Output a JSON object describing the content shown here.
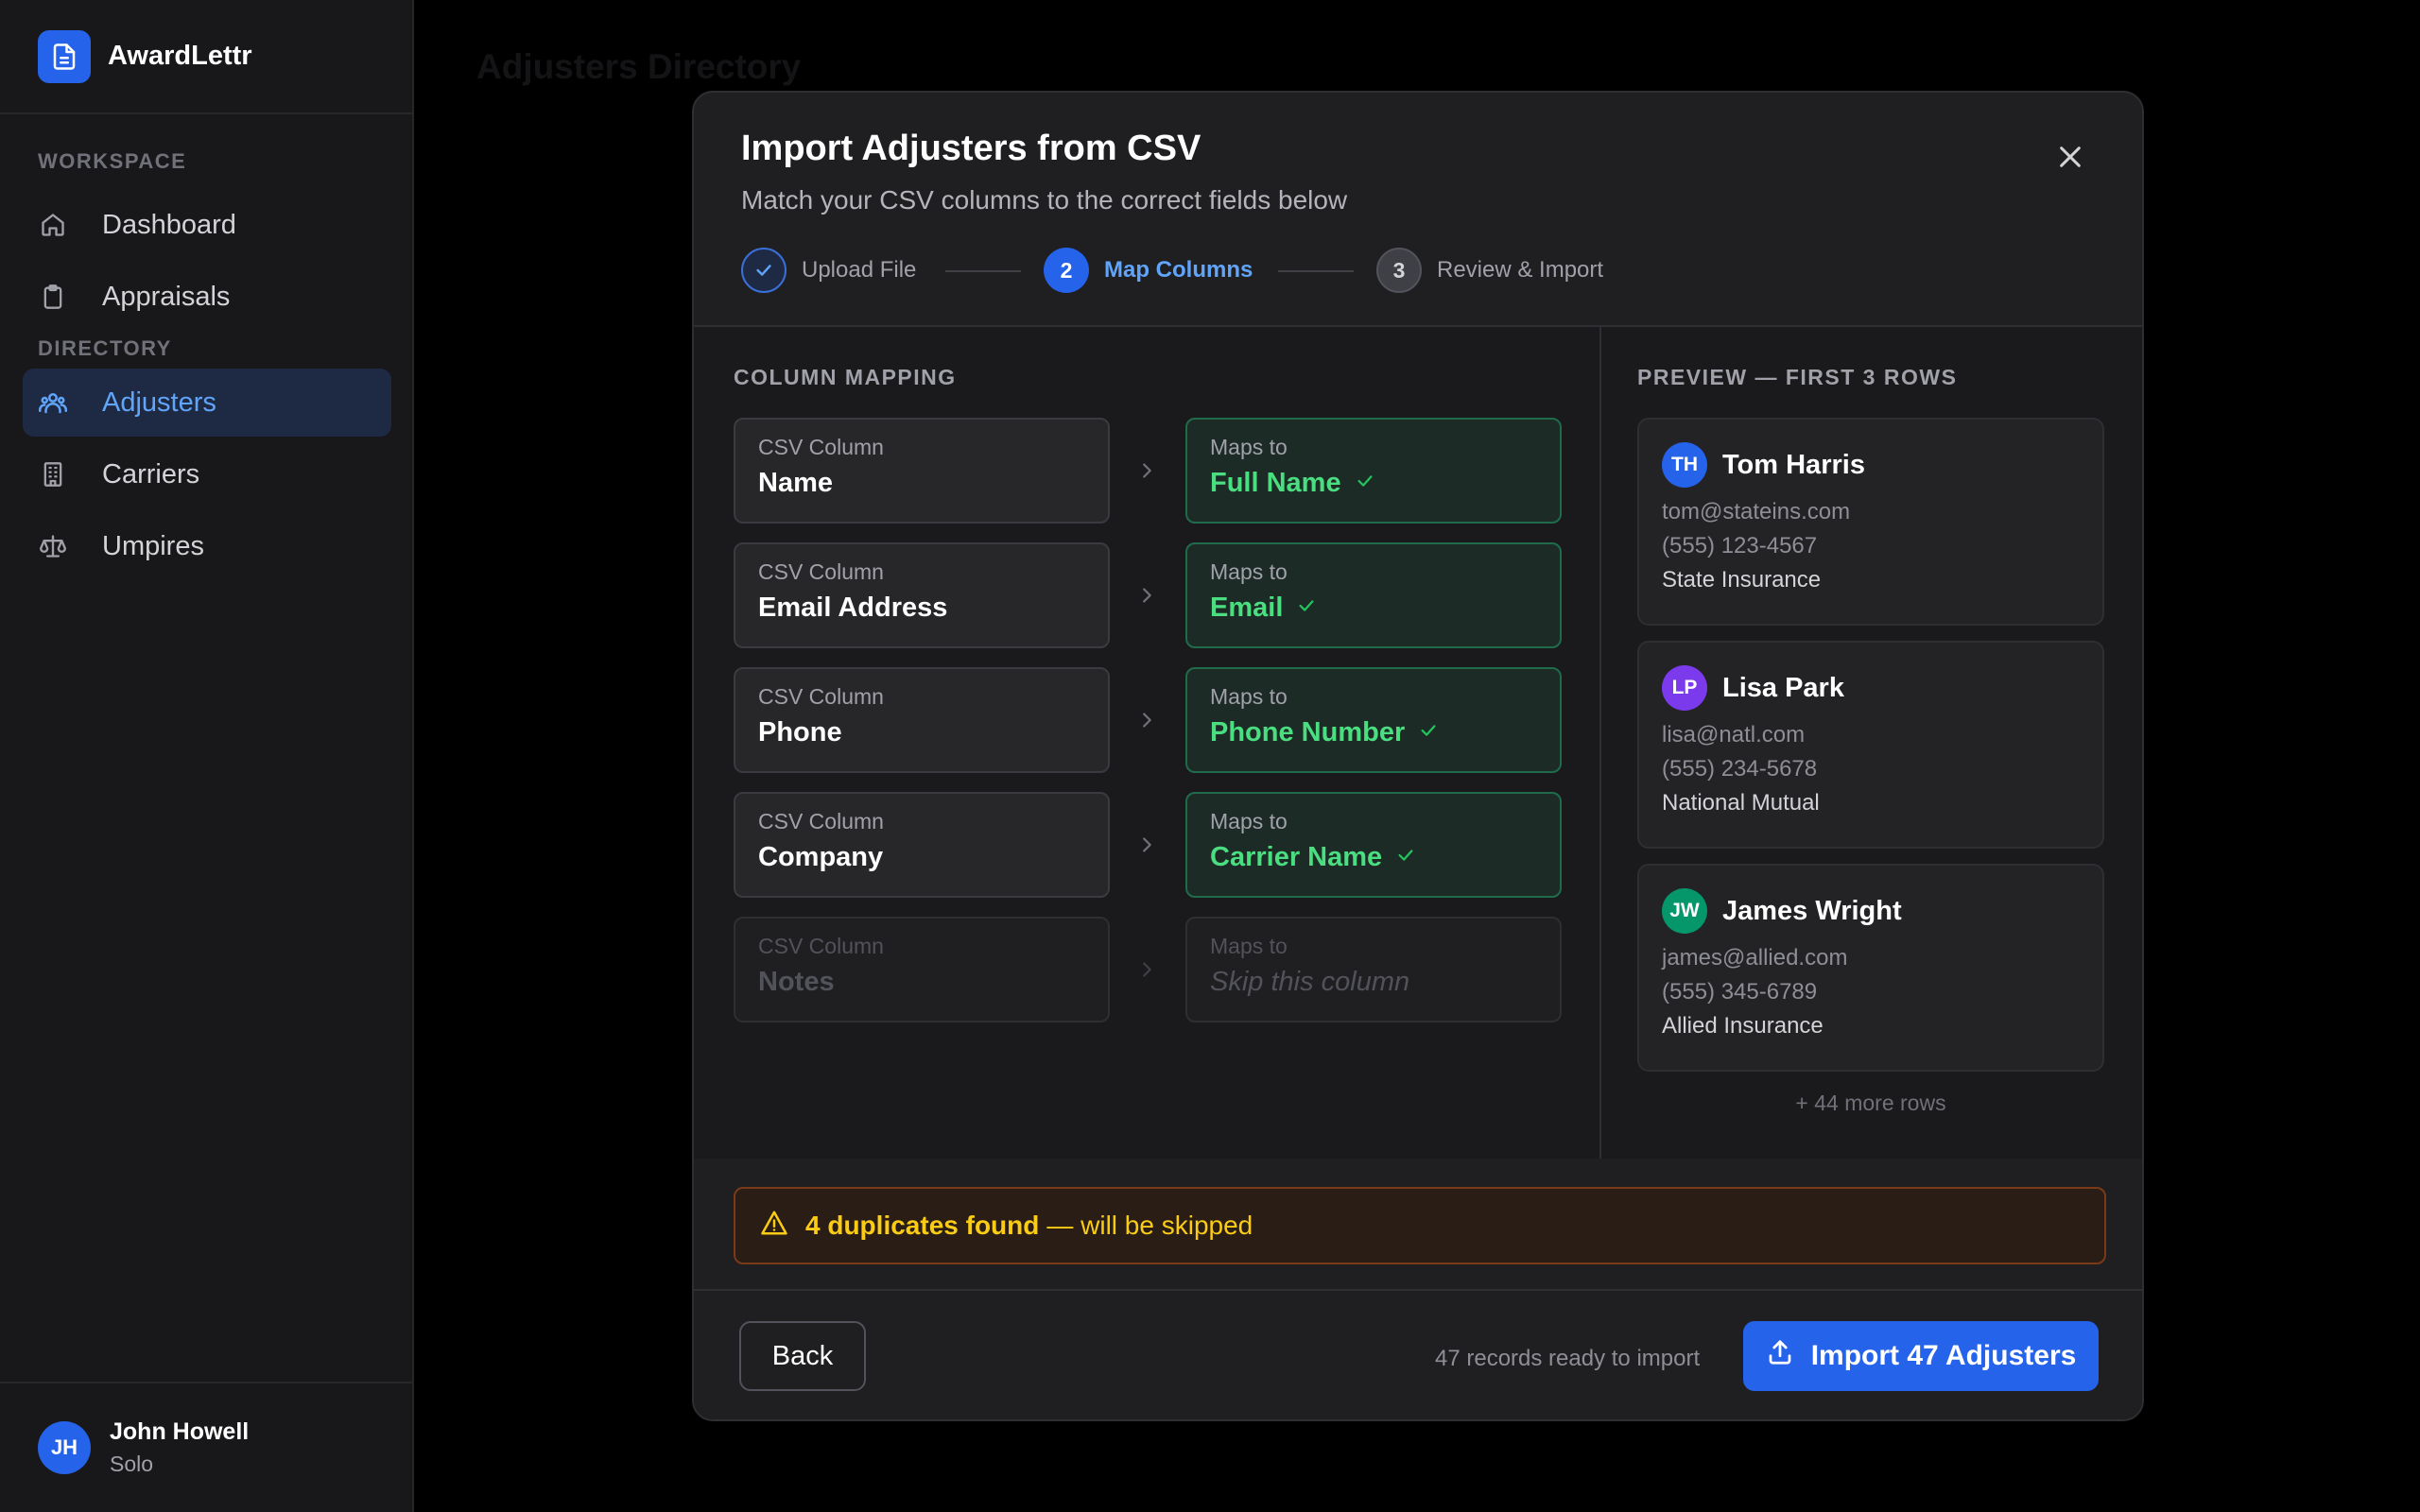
{
  "app": {
    "name": "AwardLettr"
  },
  "sidebar": {
    "sections": [
      {
        "label": "WORKSPACE"
      },
      {
        "label": "DIRECTORY"
      }
    ],
    "items": [
      {
        "label": "Dashboard",
        "icon": "home-icon"
      },
      {
        "label": "Appraisals",
        "icon": "clipboard-icon"
      },
      {
        "label": "Adjusters",
        "icon": "users-icon",
        "active": true
      },
      {
        "label": "Carriers",
        "icon": "building-icon"
      },
      {
        "label": "Umpires",
        "icon": "scale-icon"
      }
    ],
    "user": {
      "initials": "JH",
      "name": "John Howell",
      "plan": "Solo"
    }
  },
  "page": {
    "title": "Adjusters Directory"
  },
  "modal": {
    "title": "Import Adjusters from CSV",
    "subtitle": "Match your CSV columns to the correct fields below",
    "steps": [
      {
        "number": "1",
        "label": "Upload File",
        "state": "done"
      },
      {
        "number": "2",
        "label": "Map Columns",
        "state": "active"
      },
      {
        "number": "3",
        "label": "Review & Import",
        "state": "pending"
      }
    ],
    "mapping": {
      "title": "COLUMN MAPPING",
      "csv_caption": "CSV Column",
      "maps_caption": "Maps to",
      "rows": [
        {
          "csv": "Name",
          "target": "Full Name",
          "mapped": true
        },
        {
          "csv": "Email Address",
          "target": "Email",
          "mapped": true
        },
        {
          "csv": "Phone",
          "target": "Phone Number",
          "mapped": true
        },
        {
          "csv": "Company",
          "target": "Carrier Name",
          "mapped": true
        },
        {
          "csv": "Notes",
          "target": "Skip this column",
          "mapped": false
        }
      ]
    },
    "preview": {
      "title": "PREVIEW — FIRST 3 ROWS",
      "rows": [
        {
          "initials": "TH",
          "name": "Tom Harris",
          "email": "tom@stateins.com",
          "phone": "(555) 123-4567",
          "company": "State Insurance",
          "color": "#2563eb"
        },
        {
          "initials": "LP",
          "name": "Lisa Park",
          "email": "lisa@natl.com",
          "phone": "(555) 234-5678",
          "company": "National Mutual",
          "color": "#7c3aed"
        },
        {
          "initials": "JW",
          "name": "James Wright",
          "email": "james@allied.com",
          "phone": "(555) 345-6789",
          "company": "Allied Insurance",
          "color": "#059669"
        }
      ],
      "more": "+ 44 more rows"
    },
    "duplicates": {
      "strong": "4 duplicates found",
      "rest": "— will be skipped"
    },
    "footer": {
      "back_label": "Back",
      "ready_text": "47 records ready to import",
      "import_label": "Import 47 Adjusters"
    }
  },
  "colors": {
    "accent": "#2563eb",
    "accent_text": "#60a5fa",
    "success": "#4ade80",
    "warning": "#facc15"
  }
}
